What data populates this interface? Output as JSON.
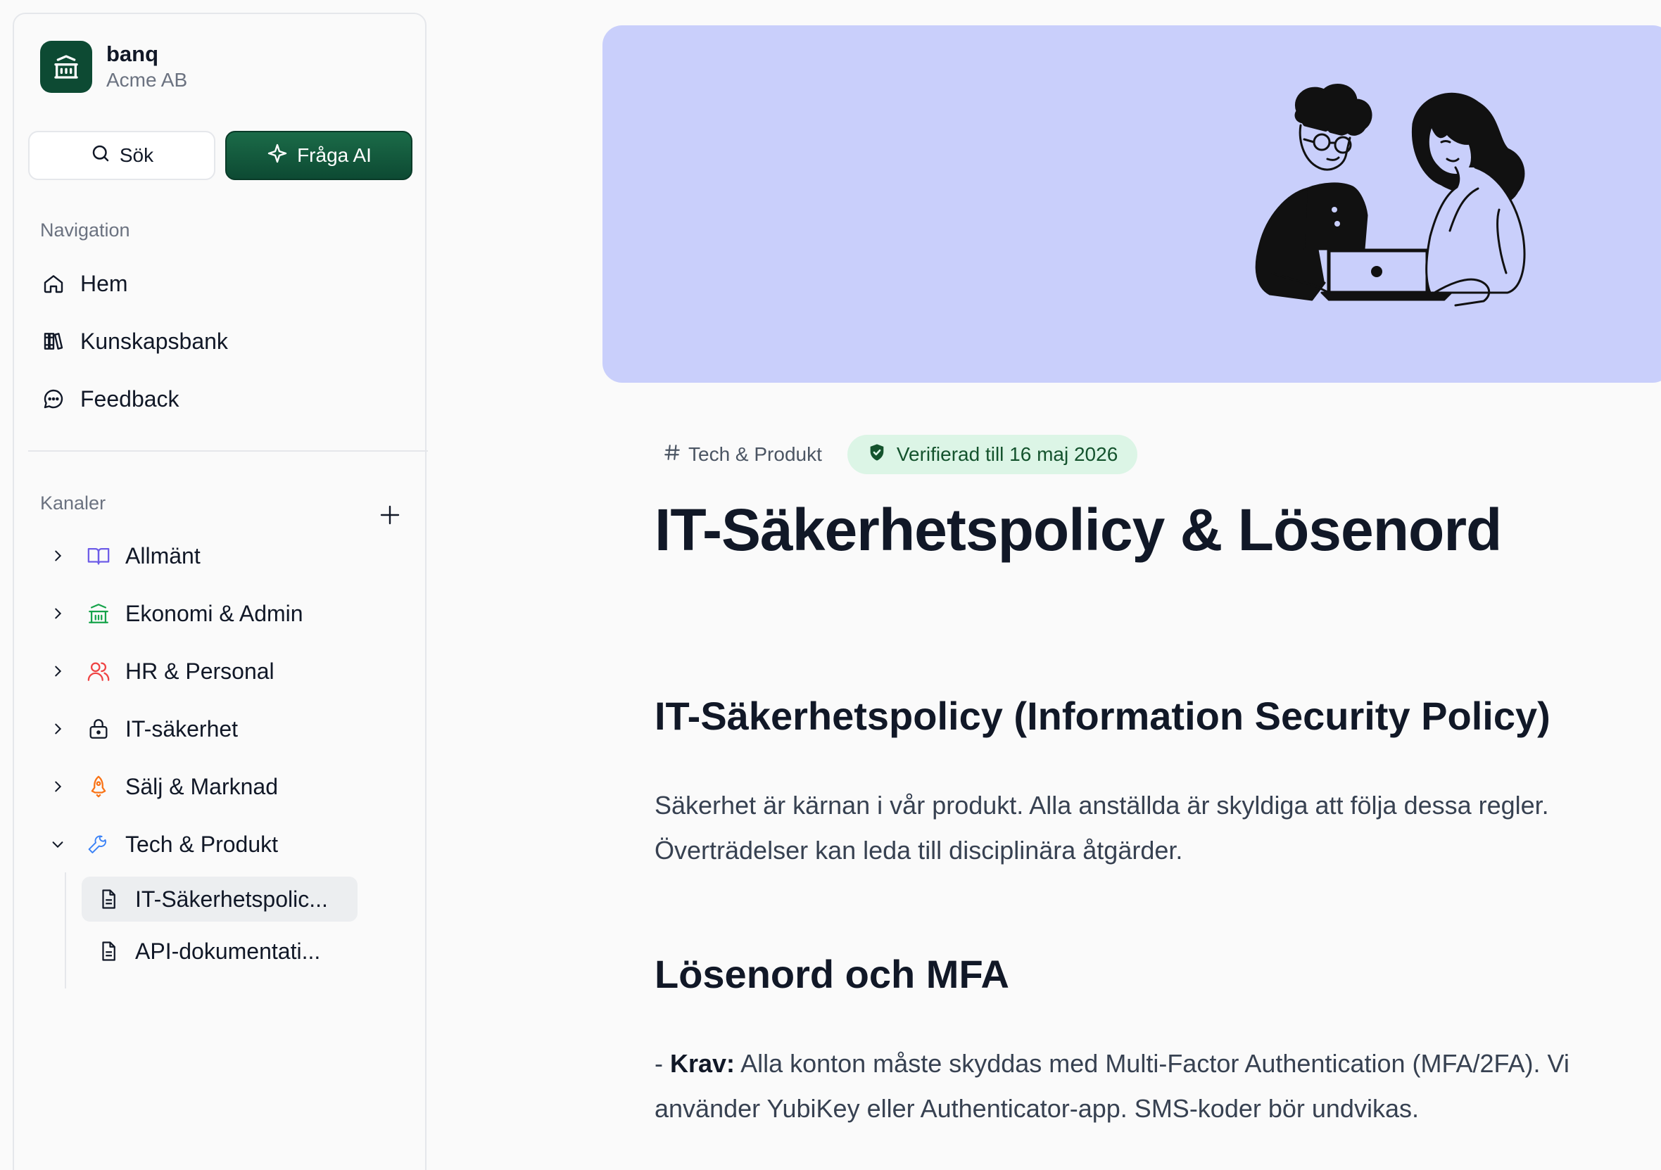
{
  "sidebar": {
    "brand": {
      "name": "banq",
      "org": "Acme AB"
    },
    "search_label": "Sök",
    "ai_label": "Fråga AI",
    "nav_heading": "Navigation",
    "nav_items": [
      {
        "label": "Hem",
        "icon": "home-icon"
      },
      {
        "label": "Kunskapsbank",
        "icon": "library-icon"
      },
      {
        "label": "Feedback",
        "icon": "chat-icon"
      }
    ],
    "channels_heading": "Kanaler",
    "channels": [
      {
        "label": "Allmänt",
        "icon": "book-open-icon",
        "color": "#6d5ce7",
        "expanded": false
      },
      {
        "label": "Ekonomi & Admin",
        "icon": "bank-icon",
        "color": "#16a34a",
        "expanded": false
      },
      {
        "label": "HR & Personal",
        "icon": "users-icon",
        "color": "#ef4444",
        "expanded": false
      },
      {
        "label": "IT-säkerhet",
        "icon": "lock-icon",
        "color": "#111827",
        "expanded": false
      },
      {
        "label": "Sälj & Marknad",
        "icon": "rocket-icon",
        "color": "#f97316",
        "expanded": false
      },
      {
        "label": "Tech & Produkt",
        "icon": "wrench-icon",
        "color": "#3b82f6",
        "expanded": true
      }
    ],
    "documents": [
      {
        "label": "IT-Säkerhetspolic...",
        "active": true
      },
      {
        "label": "API-dokumentati...",
        "active": false
      }
    ]
  },
  "main": {
    "channel_tag": "Tech & Produkt",
    "verified_tag": "Verifierad till 16 maj 2026",
    "title": "IT-Säkerhetspolicy & Lösenord",
    "section1": {
      "heading": "IT-Säkerhetspolicy (Information Security Policy)",
      "line1": "Säkerhet är kärnan i vår produkt. Alla anställda är skyldiga att följa dessa regler.",
      "line2": "Överträdelser kan leda till disciplinära åtgärder."
    },
    "section2": {
      "heading": "Lösenord och MFA",
      "prefix": "- ",
      "bold": "Krav:",
      "line1": " Alla konton måste skyddas med Multi-Factor Authentication (MFA/2FA). Vi",
      "line2": "använder YubiKey eller Authenticator-app. SMS-koder bör undvikas."
    }
  },
  "colors": {
    "brand": "#0d4a33",
    "banner": "#c9cffb",
    "verified_bg": "#dcf5e6",
    "verified_text": "#14532d"
  }
}
